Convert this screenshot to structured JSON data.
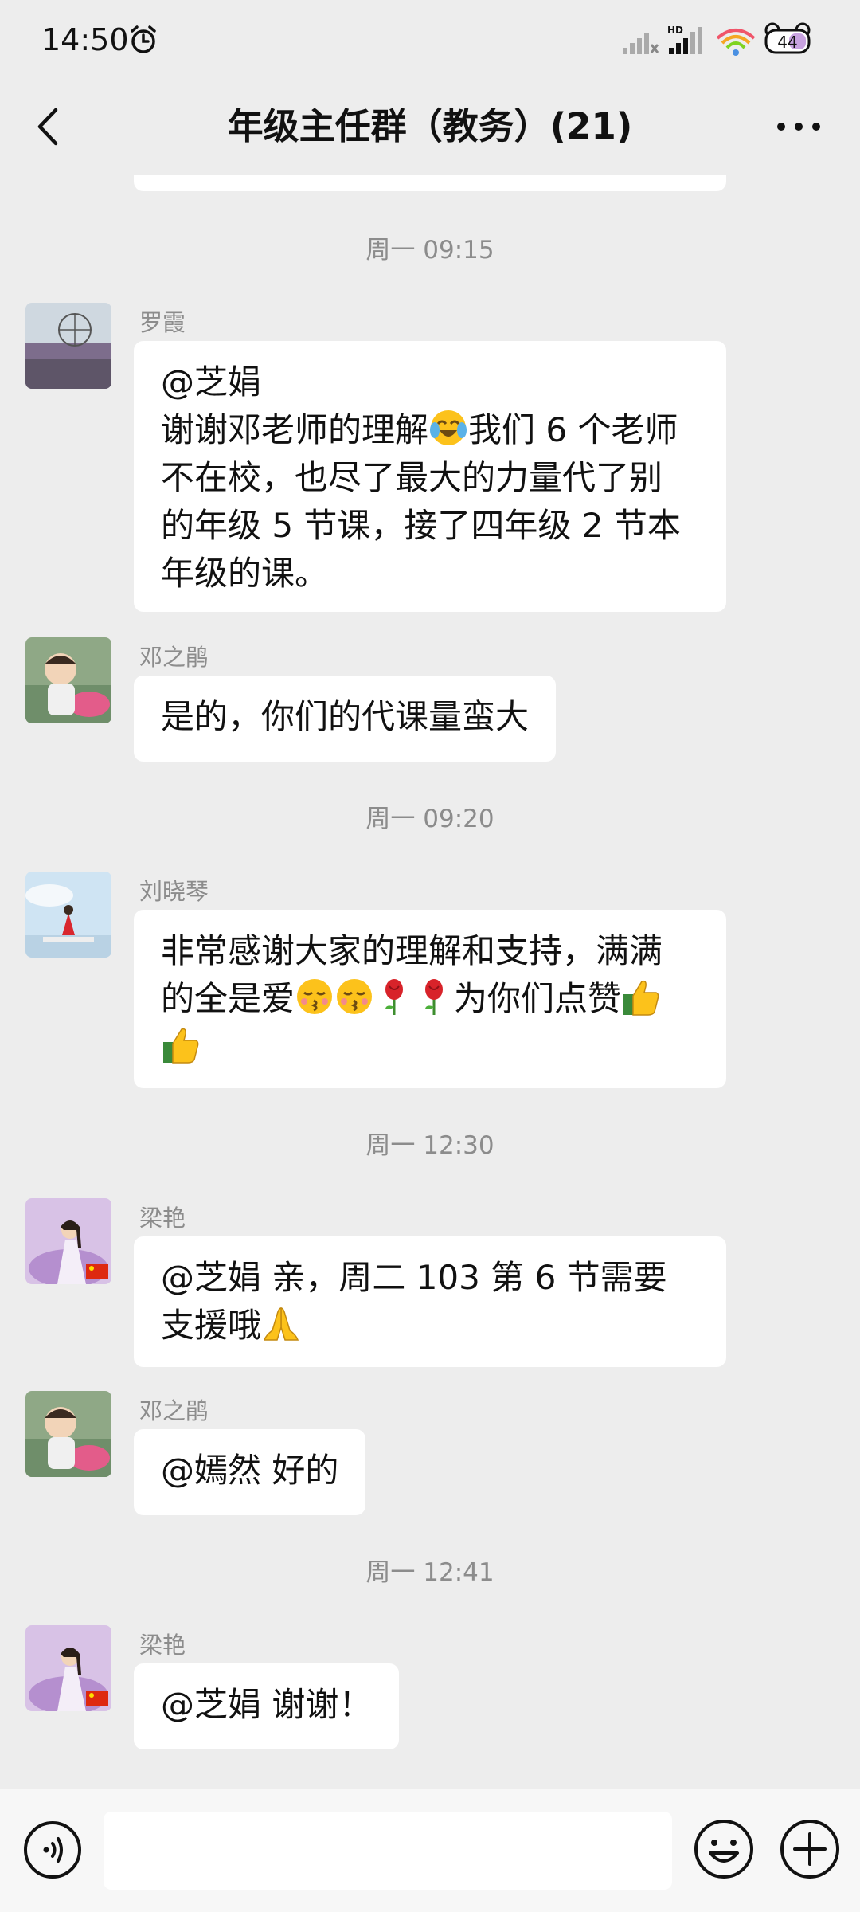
{
  "status_bar": {
    "time": "14:50",
    "battery_level": "44",
    "network_label": "HD"
  },
  "header": {
    "title": "年级主任群（教务）(21)"
  },
  "messages": [
    {
      "timestamp": "周一 09:15",
      "sender": "罗霞",
      "lines": [
        "@芝娟",
        "谢谢邓老师的理解",
        "我们 6 个老师",
        "不在校，也尽了最大的力量代了别",
        "的年级 5 节课，接了四年级 2 节本",
        "年级的课。"
      ]
    },
    {
      "sender": "邓之鹃",
      "lines": [
        "是的，你们的代课量蛮大"
      ]
    },
    {
      "timestamp": "周一 09:20",
      "sender": "刘晓琴",
      "lines": [
        "非常感谢大家的理解和支持，满满",
        "的全是爱",
        "为你们点赞"
      ]
    },
    {
      "timestamp": "周一 12:30",
      "sender": "梁艳",
      "lines": [
        "@芝娟  亲，周二 103 第 6 节需要",
        "支援哦"
      ]
    },
    {
      "sender": "邓之鹃",
      "lines": [
        "@嫣然  好的"
      ]
    },
    {
      "timestamp": "周一 12:41",
      "sender": "梁艳",
      "lines": [
        "@芝娟  谢谢！"
      ]
    }
  ],
  "icons": {
    "crying_laughing": "crying-laughing-emoji",
    "kissing": "kissing-emoji",
    "rose": "rose-emoji",
    "thumbs_up": "thumbs-up-emoji",
    "praying": "praying-hands-emoji"
  },
  "colors": {
    "background": "#ededed",
    "bubble": "#ffffff",
    "timestamp_text": "#8c8c8c"
  }
}
